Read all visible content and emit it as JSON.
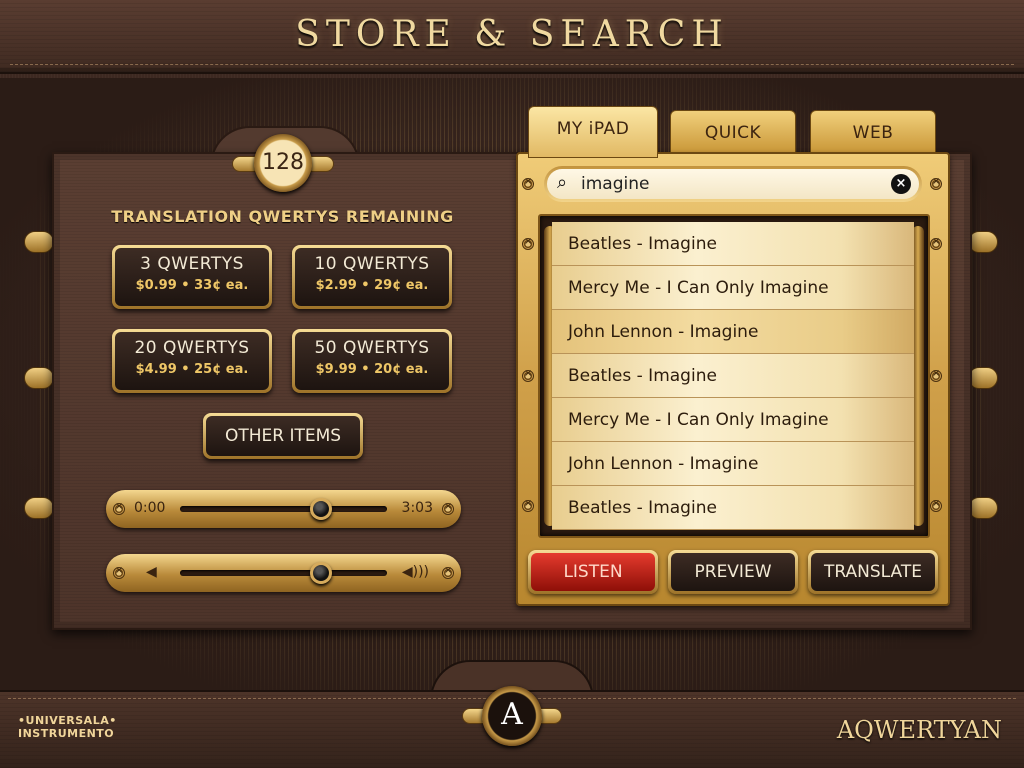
{
  "app": {
    "title": "STORE & SEARCH"
  },
  "counter": {
    "value": "128",
    "label": "TRANSLATION QWERTYS REMAINING"
  },
  "packs": [
    {
      "name": "3 QWERTYS",
      "price": "$0.99",
      "each": "33¢ ea."
    },
    {
      "name": "10 QWERTYS",
      "price": "$2.99",
      "each": "29¢ ea."
    },
    {
      "name": "20 QWERTYS",
      "price": "$4.99",
      "each": "25¢ ea."
    },
    {
      "name": "50 QWERTYS",
      "price": "$9.99",
      "each": "20¢ ea."
    }
  ],
  "other_items": "OTHER ITEMS",
  "playback": {
    "current": "0:00",
    "total": "3:03",
    "position": 0.68
  },
  "volume": {
    "level": 0.68
  },
  "tabs": [
    {
      "label": "MY iPAD",
      "active": true
    },
    {
      "label": "QUICK",
      "active": false
    },
    {
      "label": "WEB",
      "active": false
    }
  ],
  "search": {
    "value": "imagine"
  },
  "results": [
    "Beatles - Imagine",
    "Mercy Me - I Can Only Imagine",
    "John Lennon - Imagine",
    "Beatles - Imagine",
    "Mercy Me - I Can Only Imagine",
    "John Lennon - Imagine",
    "Beatles - Imagine"
  ],
  "selected_result": 2,
  "actions": {
    "listen": "LISTEN",
    "preview": "PREVIEW",
    "translate": "TRANSLATE"
  },
  "logo_letter": "A",
  "brand": {
    "left_line1": "•UNIVERSALA•",
    "left_line2": "INSTRUMENTO",
    "right": "AQWERTYAN"
  },
  "colors": {
    "gold": "#e2b65e",
    "wood": "#4d342a",
    "listen_red": "#d72a1e"
  }
}
